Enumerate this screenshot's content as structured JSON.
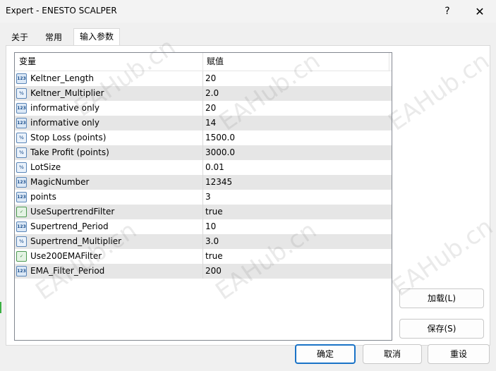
{
  "window": {
    "title": "Expert - ENESTO SCALPER",
    "help_label": "?",
    "close_label": "✕"
  },
  "tabs": [
    {
      "label": "关于"
    },
    {
      "label": "常用"
    },
    {
      "label": "输入参数",
      "active": true
    }
  ],
  "table": {
    "headers": {
      "variable": "变量",
      "value": "赋值"
    },
    "rows": [
      {
        "icon": "int-icon",
        "name": "Keltner_Length",
        "value": "20"
      },
      {
        "icon": "double-icon",
        "name": "Keltner_Multiplier",
        "value": "2.0"
      },
      {
        "icon": "int-icon",
        "name": "informative only",
        "value": "20"
      },
      {
        "icon": "int-icon",
        "name": "informative only",
        "value": "14"
      },
      {
        "icon": "double-icon",
        "name": "Stop Loss (points)",
        "value": "1500.0"
      },
      {
        "icon": "double-icon",
        "name": "Take Profit (points)",
        "value": "3000.0"
      },
      {
        "icon": "double-icon",
        "name": "LotSize",
        "value": "0.01"
      },
      {
        "icon": "int-icon",
        "name": "MagicNumber",
        "value": "12345"
      },
      {
        "icon": "int-icon",
        "name": "points",
        "value": "3"
      },
      {
        "icon": "bool-icon",
        "name": "UseSupertrendFilter",
        "value": "true"
      },
      {
        "icon": "int-icon",
        "name": "Supertrend_Period",
        "value": "10"
      },
      {
        "icon": "double-icon",
        "name": "Supertrend_Multiplier",
        "value": "3.0"
      },
      {
        "icon": "bool-icon",
        "name": "Use200EMAFilter",
        "value": "true"
      },
      {
        "icon": "int-icon",
        "name": "EMA_Filter_Period",
        "value": "200"
      }
    ]
  },
  "buttons": {
    "load": "加载(L)",
    "save": "保存(S)",
    "ok": "确定",
    "cancel": "取消",
    "reset": "重设"
  },
  "watermark": "EAHub.cn",
  "colors": {
    "accent": "#1a73c7",
    "row_alt": "#e6e6e6",
    "table_border": "#828790"
  }
}
